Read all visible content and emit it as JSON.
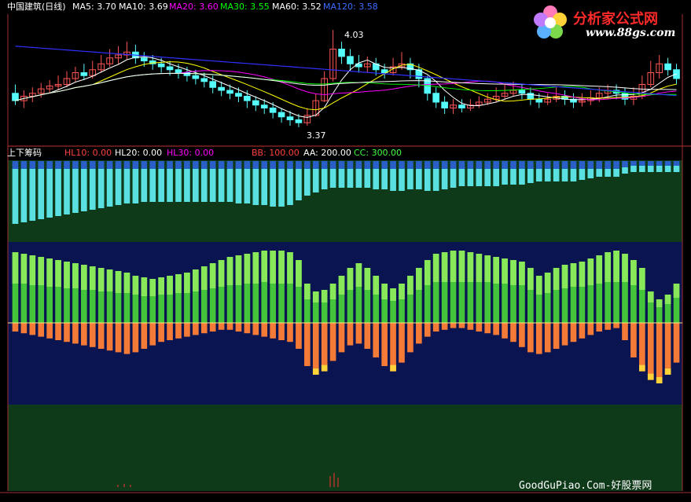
{
  "top_legend": {
    "stock_title": "中国建筑(日线)",
    "ma5": "MA5: 3.70",
    "ma10": "MA10: 3.69",
    "ma20": "MA20: 3.60",
    "ma30": "MA30: 3.55",
    "ma60": "MA60: 3.52",
    "ma120": "MA120: 3.58"
  },
  "price_annotations": {
    "high": "4.03",
    "low": "3.37"
  },
  "indicator_legend": {
    "name": "上下筹码",
    "hl10": "HL10: 0.00",
    "hl20": "HL20: 0.00",
    "hl30": "HL30: 0.00",
    "bb": "BB: 100.00",
    "aa": "AA: 200.00",
    "cc": "CC: 300.00"
  },
  "logo": {
    "text": "分析家公式网",
    "url": "www.88gs.com"
  },
  "footer_watermark": "GoodGuPiao.Com-好股票网",
  "colors": {
    "up": "#ff5555",
    "down": "#54fcfc",
    "ma5": "#ffffff",
    "ma10": "#ffff00",
    "ma20": "#ff00ff",
    "ma30": "#00ff00",
    "ma60": "#ffffff",
    "ma120": "#3030ff",
    "cyan_band": "#5ae0e0",
    "blue_band": "#2a5fc8",
    "green_band": "#44c43a",
    "green_top": "#88e85a",
    "orange_band": "#f47a38",
    "dark_green_bg": "#0f3a1a",
    "navy_bg": "#0a1450"
  },
  "chart_data": {
    "type": "bar",
    "ylim_price": [
      3.3,
      4.1
    ],
    "ylim_indicator": [
      -100,
      100
    ],
    "candles": [
      [
        3.6,
        3.55,
        3.66,
        3.52
      ],
      [
        3.55,
        3.58,
        3.62,
        3.5
      ],
      [
        3.58,
        3.6,
        3.64,
        3.54
      ],
      [
        3.6,
        3.63,
        3.67,
        3.57
      ],
      [
        3.63,
        3.65,
        3.69,
        3.6
      ],
      [
        3.65,
        3.66,
        3.72,
        3.62
      ],
      [
        3.66,
        3.7,
        3.75,
        3.64
      ],
      [
        3.7,
        3.74,
        3.78,
        3.68
      ],
      [
        3.74,
        3.72,
        3.8,
        3.69
      ],
      [
        3.72,
        3.76,
        3.82,
        3.7
      ],
      [
        3.76,
        3.8,
        3.86,
        3.74
      ],
      [
        3.8,
        3.84,
        3.9,
        3.78
      ],
      [
        3.84,
        3.86,
        3.92,
        3.8
      ],
      [
        3.86,
        3.88,
        3.95,
        3.83
      ],
      [
        3.88,
        3.84,
        3.93,
        3.8
      ],
      [
        3.84,
        3.82,
        3.88,
        3.78
      ],
      [
        3.82,
        3.8,
        3.86,
        3.76
      ],
      [
        3.8,
        3.78,
        3.84,
        3.74
      ],
      [
        3.78,
        3.76,
        3.82,
        3.72
      ],
      [
        3.76,
        3.74,
        3.8,
        3.7
      ],
      [
        3.74,
        3.72,
        3.78,
        3.68
      ],
      [
        3.72,
        3.7,
        3.76,
        3.66
      ],
      [
        3.7,
        3.68,
        3.74,
        3.64
      ],
      [
        3.68,
        3.64,
        3.72,
        3.6
      ],
      [
        3.64,
        3.62,
        3.68,
        3.58
      ],
      [
        3.62,
        3.6,
        3.66,
        3.56
      ],
      [
        3.6,
        3.58,
        3.64,
        3.54
      ],
      [
        3.58,
        3.55,
        3.62,
        3.5
      ],
      [
        3.55,
        3.52,
        3.58,
        3.48
      ],
      [
        3.52,
        3.5,
        3.56,
        3.46
      ],
      [
        3.5,
        3.47,
        3.54,
        3.43
      ],
      [
        3.47,
        3.44,
        3.5,
        3.4
      ],
      [
        3.44,
        3.42,
        3.48,
        3.38
      ],
      [
        3.42,
        3.4,
        3.46,
        3.37
      ],
      [
        3.4,
        3.45,
        3.5,
        3.38
      ],
      [
        3.45,
        3.55,
        3.6,
        3.44
      ],
      [
        3.55,
        3.7,
        3.75,
        3.54
      ],
      [
        3.7,
        3.9,
        4.03,
        3.68
      ],
      [
        3.9,
        3.85,
        3.95,
        3.8
      ],
      [
        3.85,
        3.8,
        3.9,
        3.75
      ],
      [
        3.8,
        3.78,
        3.86,
        3.74
      ],
      [
        3.78,
        3.8,
        3.85,
        3.74
      ],
      [
        3.8,
        3.76,
        3.84,
        3.72
      ],
      [
        3.76,
        3.74,
        3.8,
        3.7
      ],
      [
        3.74,
        3.78,
        3.84,
        3.72
      ],
      [
        3.78,
        3.8,
        3.88,
        3.76
      ],
      [
        3.8,
        3.76,
        3.84,
        3.7
      ],
      [
        3.76,
        3.7,
        3.8,
        3.64
      ],
      [
        3.7,
        3.6,
        3.72,
        3.55
      ],
      [
        3.6,
        3.54,
        3.64,
        3.5
      ],
      [
        3.54,
        3.5,
        3.58,
        3.46
      ],
      [
        3.5,
        3.52,
        3.56,
        3.46
      ],
      [
        3.52,
        3.5,
        3.56,
        3.47
      ],
      [
        3.5,
        3.52,
        3.56,
        3.48
      ],
      [
        3.52,
        3.54,
        3.58,
        3.5
      ],
      [
        3.54,
        3.56,
        3.6,
        3.52
      ],
      [
        3.56,
        3.58,
        3.64,
        3.54
      ],
      [
        3.58,
        3.6,
        3.66,
        3.56
      ],
      [
        3.6,
        3.62,
        3.68,
        3.58
      ],
      [
        3.62,
        3.6,
        3.66,
        3.56
      ],
      [
        3.6,
        3.56,
        3.64,
        3.52
      ],
      [
        3.56,
        3.54,
        3.6,
        3.5
      ],
      [
        3.54,
        3.56,
        3.6,
        3.52
      ],
      [
        3.56,
        3.58,
        3.64,
        3.54
      ],
      [
        3.58,
        3.56,
        3.62,
        3.52
      ],
      [
        3.56,
        3.54,
        3.6,
        3.5
      ],
      [
        3.54,
        3.55,
        3.6,
        3.51
      ],
      [
        3.55,
        3.57,
        3.62,
        3.52
      ],
      [
        3.57,
        3.6,
        3.64,
        3.54
      ],
      [
        3.6,
        3.62,
        3.66,
        3.56
      ],
      [
        3.62,
        3.6,
        3.66,
        3.56
      ],
      [
        3.6,
        3.56,
        3.64,
        3.52
      ],
      [
        3.56,
        3.58,
        3.64,
        3.52
      ],
      [
        3.58,
        3.66,
        3.72,
        3.56
      ],
      [
        3.66,
        3.74,
        3.82,
        3.64
      ],
      [
        3.74,
        3.8,
        3.86,
        3.7
      ],
      [
        3.8,
        3.76,
        3.84,
        3.72
      ],
      [
        3.76,
        3.7,
        3.8,
        3.66
      ]
    ],
    "cyan_bars": [
      [
        70,
        10
      ],
      [
        68,
        10
      ],
      [
        66,
        10
      ],
      [
        64,
        10
      ],
      [
        62,
        10
      ],
      [
        60,
        10
      ],
      [
        58,
        10
      ],
      [
        56,
        10
      ],
      [
        54,
        10
      ],
      [
        52,
        10
      ],
      [
        50,
        10
      ],
      [
        48,
        10
      ],
      [
        46,
        10
      ],
      [
        44,
        10
      ],
      [
        44,
        10
      ],
      [
        42,
        10
      ],
      [
        42,
        10
      ],
      [
        42,
        10
      ],
      [
        42,
        10
      ],
      [
        42,
        10
      ],
      [
        42,
        10
      ],
      [
        42,
        10
      ],
      [
        42,
        10
      ],
      [
        42,
        10
      ],
      [
        42,
        10
      ],
      [
        42,
        10
      ],
      [
        44,
        10
      ],
      [
        44,
        10
      ],
      [
        46,
        10
      ],
      [
        46,
        10
      ],
      [
        48,
        10
      ],
      [
        48,
        10
      ],
      [
        46,
        10
      ],
      [
        40,
        10
      ],
      [
        34,
        10
      ],
      [
        30,
        10
      ],
      [
        26,
        10
      ],
      [
        24,
        10
      ],
      [
        24,
        10
      ],
      [
        24,
        10
      ],
      [
        24,
        10
      ],
      [
        24,
        10
      ],
      [
        26,
        10
      ],
      [
        26,
        10
      ],
      [
        28,
        10
      ],
      [
        28,
        10
      ],
      [
        26,
        10
      ],
      [
        26,
        10
      ],
      [
        28,
        10
      ],
      [
        28,
        10
      ],
      [
        26,
        10
      ],
      [
        24,
        10
      ],
      [
        22,
        10
      ],
      [
        22,
        10
      ],
      [
        22,
        10
      ],
      [
        22,
        10
      ],
      [
        22,
        10
      ],
      [
        20,
        10
      ],
      [
        20,
        10
      ],
      [
        20,
        10
      ],
      [
        18,
        10
      ],
      [
        16,
        10
      ],
      [
        16,
        10
      ],
      [
        16,
        10
      ],
      [
        16,
        10
      ],
      [
        16,
        10
      ],
      [
        14,
        10
      ],
      [
        12,
        10
      ],
      [
        10,
        10
      ],
      [
        10,
        10
      ],
      [
        10,
        10
      ],
      [
        8,
        8
      ],
      [
        8,
        6
      ],
      [
        8,
        6
      ],
      [
        8,
        6
      ],
      [
        8,
        6
      ],
      [
        8,
        6
      ],
      [
        8,
        6
      ]
    ],
    "green_bars": [
      [
        90,
        40
      ],
      [
        88,
        38
      ],
      [
        86,
        38
      ],
      [
        84,
        36
      ],
      [
        82,
        36
      ],
      [
        80,
        34
      ],
      [
        78,
        34
      ],
      [
        76,
        32
      ],
      [
        74,
        32
      ],
      [
        72,
        30
      ],
      [
        70,
        30
      ],
      [
        68,
        28
      ],
      [
        66,
        28
      ],
      [
        64,
        26
      ],
      [
        60,
        24
      ],
      [
        58,
        24
      ],
      [
        56,
        22
      ],
      [
        58,
        22
      ],
      [
        60,
        24
      ],
      [
        62,
        24
      ],
      [
        64,
        26
      ],
      [
        68,
        28
      ],
      [
        72,
        30
      ],
      [
        76,
        32
      ],
      [
        80,
        34
      ],
      [
        84,
        36
      ],
      [
        86,
        38
      ],
      [
        88,
        38
      ],
      [
        90,
        40
      ],
      [
        92,
        40
      ],
      [
        92,
        42
      ],
      [
        92,
        42
      ],
      [
        90,
        40
      ],
      [
        80,
        34
      ],
      [
        50,
        20
      ],
      [
        40,
        14
      ],
      [
        42,
        16
      ],
      [
        50,
        20
      ],
      [
        60,
        24
      ],
      [
        70,
        28
      ],
      [
        76,
        30
      ],
      [
        70,
        28
      ],
      [
        60,
        24
      ],
      [
        50,
        20
      ],
      [
        44,
        16
      ],
      [
        50,
        20
      ],
      [
        60,
        24
      ],
      [
        70,
        28
      ],
      [
        80,
        32
      ],
      [
        88,
        36
      ],
      [
        90,
        38
      ],
      [
        92,
        40
      ],
      [
        92,
        40
      ],
      [
        90,
        38
      ],
      [
        88,
        36
      ],
      [
        86,
        34
      ],
      [
        84,
        34
      ],
      [
        82,
        32
      ],
      [
        80,
        32
      ],
      [
        78,
        30
      ],
      [
        70,
        28
      ],
      [
        60,
        24
      ],
      [
        64,
        26
      ],
      [
        70,
        28
      ],
      [
        74,
        30
      ],
      [
        76,
        30
      ],
      [
        78,
        32
      ],
      [
        82,
        34
      ],
      [
        86,
        36
      ],
      [
        90,
        38
      ],
      [
        92,
        40
      ],
      [
        88,
        36
      ],
      [
        80,
        32
      ],
      [
        70,
        28
      ],
      [
        40,
        14
      ],
      [
        30,
        10
      ],
      [
        36,
        12
      ],
      [
        50,
        18
      ]
    ],
    "orange_bars": [
      [
        -10,
        -4
      ],
      [
        -12,
        -4
      ],
      [
        -14,
        -6
      ],
      [
        -16,
        -6
      ],
      [
        -18,
        -6
      ],
      [
        -20,
        -8
      ],
      [
        -22,
        -8
      ],
      [
        -24,
        -8
      ],
      [
        -26,
        -10
      ],
      [
        -28,
        -10
      ],
      [
        -30,
        -10
      ],
      [
        -32,
        -12
      ],
      [
        -34,
        -12
      ],
      [
        -36,
        -12
      ],
      [
        -34,
        -12
      ],
      [
        -30,
        -10
      ],
      [
        -26,
        -10
      ],
      [
        -22,
        -8
      ],
      [
        -20,
        -8
      ],
      [
        -18,
        -6
      ],
      [
        -16,
        -6
      ],
      [
        -14,
        -6
      ],
      [
        -12,
        -4
      ],
      [
        -10,
        -4
      ],
      [
        -8,
        -4
      ],
      [
        -8,
        -4
      ],
      [
        -10,
        -4
      ],
      [
        -12,
        -4
      ],
      [
        -14,
        -6
      ],
      [
        -16,
        -6
      ],
      [
        -18,
        -6
      ],
      [
        -20,
        -8
      ],
      [
        -22,
        -8
      ],
      [
        -30,
        -10
      ],
      [
        -50,
        -18
      ],
      [
        -60,
        -20
      ],
      [
        -56,
        -20
      ],
      [
        -44,
        -16
      ],
      [
        -34,
        -12
      ],
      [
        -26,
        -10
      ],
      [
        -24,
        -8
      ],
      [
        -30,
        -10
      ],
      [
        -40,
        -14
      ],
      [
        -50,
        -18
      ],
      [
        -56,
        -20
      ],
      [
        -46,
        -16
      ],
      [
        -34,
        -12
      ],
      [
        -24,
        -8
      ],
      [
        -16,
        -6
      ],
      [
        -10,
        -4
      ],
      [
        -8,
        -4
      ],
      [
        -6,
        -2
      ],
      [
        -6,
        -2
      ],
      [
        -8,
        -4
      ],
      [
        -10,
        -4
      ],
      [
        -12,
        -4
      ],
      [
        -14,
        -6
      ],
      [
        -18,
        -6
      ],
      [
        -22,
        -8
      ],
      [
        -28,
        -10
      ],
      [
        -34,
        -12
      ],
      [
        -36,
        -12
      ],
      [
        -34,
        -12
      ],
      [
        -30,
        -10
      ],
      [
        -26,
        -10
      ],
      [
        -22,
        -8
      ],
      [
        -18,
        -6
      ],
      [
        -14,
        -6
      ],
      [
        -10,
        -4
      ],
      [
        -8,
        -4
      ],
      [
        -6,
        -2
      ],
      [
        -20,
        -8
      ],
      [
        -40,
        -14
      ],
      [
        -56,
        -20
      ],
      [
        -66,
        -22
      ],
      [
        -70,
        -24
      ],
      [
        -60,
        -20
      ],
      [
        -46,
        -16
      ]
    ]
  }
}
